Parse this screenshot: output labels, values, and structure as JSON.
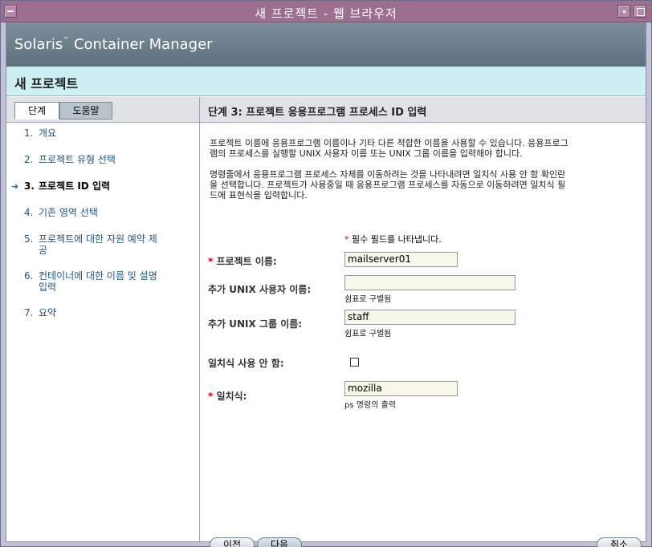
{
  "window": {
    "title": "새 프로젝트 - 웹 브라우저"
  },
  "masthead": {
    "brand": "Solaris",
    "tm": "™",
    "brand_suffix": " Container Manager"
  },
  "page": {
    "title": "새 프로젝트"
  },
  "tabs": {
    "steps": "단계",
    "help": "도움말"
  },
  "steps": [
    {
      "num": "1.",
      "label": "개요"
    },
    {
      "num": "2.",
      "label": "프로젝트 유형 선택"
    },
    {
      "num": "3.",
      "label": "프로젝트 ID 입력"
    },
    {
      "num": "4.",
      "label": "기존 영역 선택"
    },
    {
      "num": "5.",
      "label": "프로젝트에 대한 자원 예약 제",
      "label2": "공"
    },
    {
      "num": "6.",
      "label": "컨테이너에 대한 이름 및 설명",
      "label2": "입력"
    },
    {
      "num": "7.",
      "label": "요약"
    }
  ],
  "step_header": "단계 3:  프로젝트 응용프로그램 프로세스 ID 입력",
  "help": {
    "p1_line1": "프로젝트 이름에 응용프로그램 이름이나 기타 다른 적합한 이름을 사용할 수 있습니다. 응용프로그",
    "p1_line2": "램의 프로세스를 실행할 UNIX 사용자 이름 또는 UNIX 그룹 이름을 입력해야 합니다.",
    "p2_line1": "명령줄에서 응용프로그램 프로세스 자체를 이동하려는 것을 나타내려면 일치식 사용 안 함 확인란",
    "p2_line2": "을 선택합니다. 프로젝트가 사용중일 때 응용프로그램 프로세스를 자동으로 이동하려면 일치식 필",
    "p2_line3": "드에 표현식을 입력합니다."
  },
  "required_note": "필수 필드를 나타냅니다.",
  "required_star": "*",
  "form": {
    "project_name": {
      "label": "프로젝트 이름:",
      "value": "mailserver01"
    },
    "unix_user": {
      "label": "추가 UNIX 사용자 이름:",
      "value": "",
      "hint": "쉼표로 구별됨"
    },
    "unix_group": {
      "label": "추가 UNIX 그룹 이름:",
      "value": "staff",
      "hint": "쉼표로 구별됨"
    },
    "disable_match": {
      "label": "일치식 사용 안 함:",
      "checked": false
    },
    "match": {
      "label": "일치식:",
      "value": "mozilla",
      "hint": "ps 명령의 출력"
    }
  },
  "buttons": {
    "prev": "이전",
    "next": "다음",
    "cancel": "취소"
  },
  "current_step_index": 2
}
